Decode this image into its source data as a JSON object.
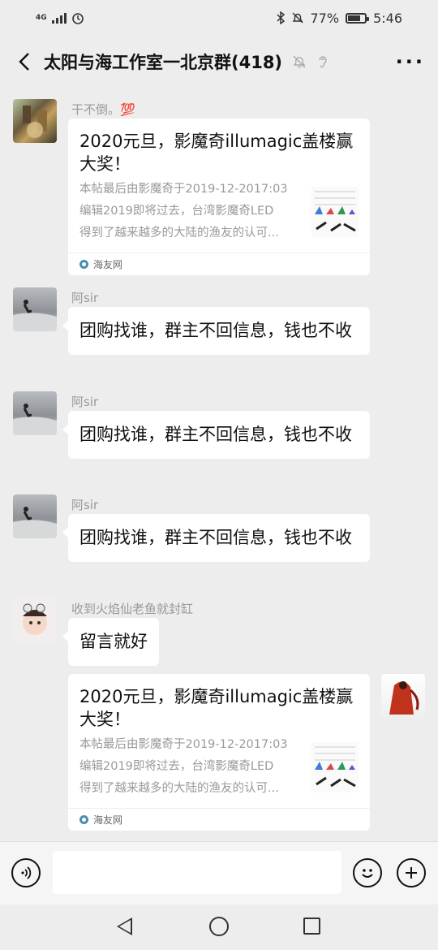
{
  "status": {
    "network": "4G",
    "battery": "77%",
    "battery_level": 0.77,
    "time": "5:46"
  },
  "header": {
    "title": "太阳与海工作室一北京群(418)",
    "back_icon": "back-arrow",
    "mute_icon": "bell-off",
    "ear_icon": "ear",
    "more_icon": "more-dots"
  },
  "messages": [
    {
      "sender": "干不倒。💯",
      "card_title": "2020元旦，影魔奇illumagic盖楼赢大奖！",
      "card_desc": [
        "本帖最后由影魔奇于2019-12-2017:03",
        "编辑2019即将过去，台湾影魔奇LED",
        "得到了越来越多的大陆的渔友的认可..."
      ],
      "card_source": "海友网"
    },
    {
      "sender": "阿sir",
      "text": "团购找谁，群主不回信息，钱也不收"
    },
    {
      "sender": "阿sir",
      "text": "团购找谁，群主不回信息，钱也不收"
    },
    {
      "sender": "阿sir",
      "text": "团购找谁，群主不回信息，钱也不收"
    },
    {
      "sender": "收到火焰仙老鱼就封缸",
      "text": "留言就好"
    },
    {
      "sender": "",
      "card_title": "2020元旦，影魔奇illumagic盖楼赢大奖！",
      "card_desc": [
        "本帖最后由影魔奇于2019-12-2017:03",
        "编辑2019即将过去，台湾影魔奇LED",
        "得到了越来越多的大陆的渔友的认可..."
      ],
      "card_source": "海友网"
    }
  ],
  "input": {
    "voice_icon": "voice",
    "emoji_icon": "emoji",
    "plus_icon": "plus"
  },
  "colors": {
    "background": "#ededed",
    "bubble": "#ffffff",
    "meta_text": "#999999"
  }
}
